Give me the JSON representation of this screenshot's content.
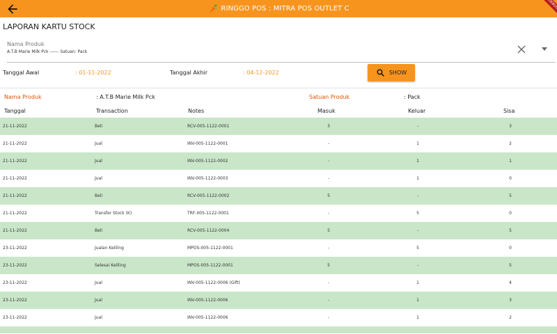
{
  "app_bar": {
    "title": "RINGGO POS : MITRA POS OUTLET C",
    "debug_banner": "DEBUG",
    "color": "#f7941d"
  },
  "icons": {
    "back": "arrow-left-icon",
    "logo": "carrot-logo-icon",
    "clear": "close-icon",
    "dropdown": "caret-down-icon",
    "search": "search-icon"
  },
  "page": {
    "title": "LAPORAN KARTU STOCK"
  },
  "product_field": {
    "label": "Nama Produk",
    "value": "A.T.B Marie Milk Pck ------ Satuan: Pack"
  },
  "filters": {
    "start_label": "Tanggal Awal",
    "start_value": ": 01-11-2022",
    "end_label": "Tanggal Akhir",
    "end_value": ": 04-12-2022",
    "show_label": "SHOW"
  },
  "summary": {
    "product_key": "Nama Produk",
    "product_value": ": A.T.B Marie Milk Pck",
    "unit_key": "Satuan Produk",
    "unit_value": ": Pack"
  },
  "table": {
    "columns": [
      "Tanggal",
      "Transaction",
      "Notes",
      "Masuk",
      "Keluar",
      "Sisa"
    ],
    "row_colors": {
      "even": "#c9e6c9",
      "odd": "#ffffff"
    },
    "rows": [
      [
        "21-11-2022",
        "Beli",
        "RCV-005-1122-0001",
        "3",
        "-",
        "3"
      ],
      [
        "21-11-2022",
        "Jual",
        "INV-005-1122-0001",
        "-",
        "1",
        "2"
      ],
      [
        "21-11-2022",
        "Jual",
        "INV-005-1122-0002",
        "-",
        "1",
        "1"
      ],
      [
        "21-11-2022",
        "Jual",
        "INV-005-1122-0003",
        "-",
        "1",
        "0"
      ],
      [
        "21-11-2022",
        "Beli",
        "RCV-005-1122-0002",
        "5",
        "-",
        "5"
      ],
      [
        "21-11-2022",
        "Transfer Stock (K)",
        "TRF-005-1122-0001",
        "-",
        "5",
        "0"
      ],
      [
        "21-11-2022",
        "Beli",
        "RCV-005-1122-0004",
        "5",
        "-",
        "5"
      ],
      [
        "23-11-2022",
        "Jualan Keliling",
        "MPOS-005-1122-0001",
        "-",
        "5",
        "0"
      ],
      [
        "23-11-2022",
        "Selesai Keliling",
        "MPOS-005-1122-0001",
        "5",
        "-",
        "5"
      ],
      [
        "23-11-2022",
        "Jual",
        "INV-005-1122-0006 (Gift)",
        "-",
        "1",
        "4"
      ],
      [
        "23-11-2022",
        "Jual",
        "INV-005-1122-0006",
        "-",
        "1",
        "3"
      ],
      [
        "23-11-2022",
        "Jual",
        "INV-005-1122-0006",
        "-",
        "1",
        "2"
      ]
    ]
  }
}
